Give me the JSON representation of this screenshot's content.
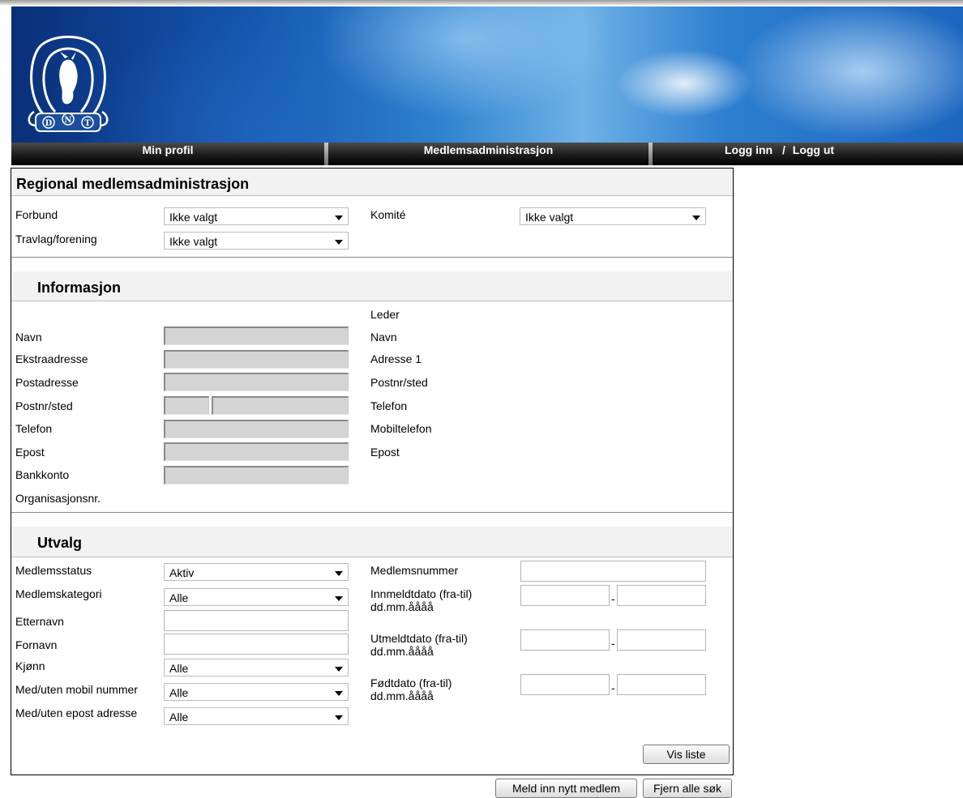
{
  "nav": {
    "min_profil": "Min profil",
    "medlemsadmin": "Medlemsadministrasjon",
    "logg_inn": "Logg inn",
    "slash": "/",
    "logg_ut": "Logg ut"
  },
  "header_logo_letters": [
    "D",
    "N",
    "T"
  ],
  "title": "Regional medlemsadministrasjon",
  "filters": {
    "forbund_label": "Forbund",
    "forbund_value": "Ikke valgt",
    "travlag_label": "Travlag/forening",
    "travlag_value": "Ikke valgt",
    "komite_label": "Komité",
    "komite_value": "Ikke valgt"
  },
  "info": {
    "heading": "Informasjon",
    "left_labels": [
      "Navn",
      "Ekstraadresse",
      "Postadresse",
      "Postnr/sted",
      "Telefon",
      "Epost",
      "Bankkonto",
      "Organisasjonsnr."
    ],
    "leder_heading": "Leder",
    "right_labels": [
      "Navn",
      "Adresse 1",
      "Postnr/sted",
      "Telefon",
      "Mobiltelefon",
      "Epost"
    ]
  },
  "utvalg": {
    "heading": "Utvalg",
    "medlemsstatus_label": "Medlemsstatus",
    "medlemsstatus_value": "Aktiv",
    "medlemskategori_label": "Medlemskategori",
    "medlemskategori_value": "Alle",
    "etternavn_label": "Etternavn",
    "fornavn_label": "Fornavn",
    "kjonn_label": "Kjønn",
    "kjonn_value": "Alle",
    "mobil_label": "Med/uten mobil nummer",
    "mobil_value": "Alle",
    "epost_label": "Med/uten epost adresse",
    "epost_value": "Alle",
    "medlemsnummer_label": "Medlemsnummer",
    "innmeldt_label": "Innmeldtdato (fra-til)",
    "utmeldt_label": "Utmeldtdato (fra-til)",
    "fodt_label": "Fødtdato (fra-til)",
    "date_format": "dd.mm.åååå",
    "range_sep": "-"
  },
  "buttons": {
    "vis_liste": "Vis liste",
    "meld_inn": "Meld inn nytt medlem",
    "fjern": "Fjern alle søk"
  }
}
